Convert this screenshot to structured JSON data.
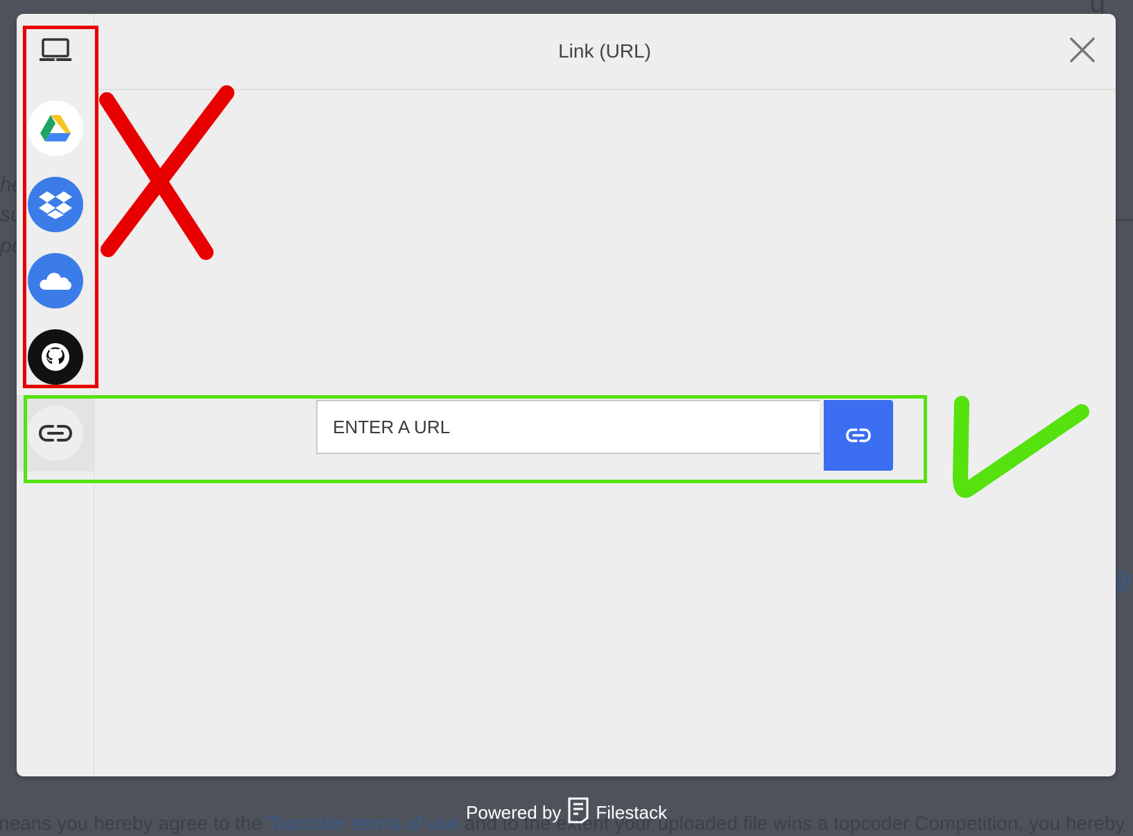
{
  "background": {
    "bottom_text_prefix": "neans you hereby agree to the ",
    "bottom_link": "Topcoder terms of use",
    "bottom_text_suffix": " and to the extent your uploaded file wins a topcoder Competition, you hereby"
  },
  "sidebar": {
    "items": [
      {
        "name": "My Device",
        "icon": "laptop-icon"
      },
      {
        "name": "Google Drive",
        "icon": "google-drive-icon"
      },
      {
        "name": "Dropbox",
        "icon": "dropbox-icon"
      },
      {
        "name": "OneDrive",
        "icon": "onedrive-icon"
      },
      {
        "name": "GitHub",
        "icon": "github-icon"
      },
      {
        "name": "Link (URL)",
        "icon": "link-icon",
        "active": true
      }
    ]
  },
  "header": {
    "title": "Link (URL)"
  },
  "url": {
    "placeholder": "ENTER A URL",
    "value": ""
  },
  "footer": {
    "powered_by": "Powered by",
    "brand": "Filestack"
  },
  "colors": {
    "accent": "#3b6ef0",
    "annotation_reject": "#e80000",
    "annotation_accept": "#55e20f"
  }
}
